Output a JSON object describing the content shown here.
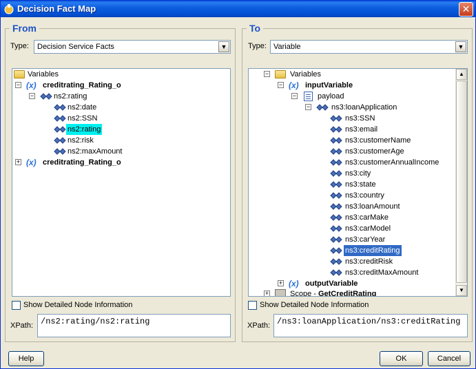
{
  "window": {
    "title": "Decision Fact Map",
    "close_label": "✕"
  },
  "from": {
    "legend": "From",
    "type_label": "Type:",
    "type_value": "Decision Service Facts",
    "tree": {
      "root": "Variables",
      "rating_o_1": "creditrating_Rating_o",
      "rating": "ns2:rating",
      "items": [
        "ns2:date",
        "ns2:SSN",
        "ns2:rating",
        "ns2:risk",
        "ns2:maxAmount"
      ],
      "rating_o_2": "creditrating_Rating_o",
      "var_symbol": "(x)"
    },
    "show_detail": "Show Detailed Node Information",
    "xpath_label": "XPath:",
    "xpath_value": "/ns2:rating/ns2:rating"
  },
  "to": {
    "legend": "To",
    "type_label": "Type:",
    "type_value": "Variable",
    "tree": {
      "root": "Variables",
      "input_var": "inputVariable",
      "payload": "payload",
      "loan_app": "ns3:loanApplication",
      "items": [
        "ns3:SSN",
        "ns3:email",
        "ns3:customerName",
        "ns3:customerAge",
        "ns3:customerAnnualIncome",
        "ns3:city",
        "ns3:state",
        "ns3:country",
        "ns3:loanAmount",
        "ns3:carMake",
        "ns3:carModel",
        "ns3:carYear",
        "ns3:creditRating",
        "ns3:creditRisk",
        "ns3:creditMaxAmount"
      ],
      "output_var": "outputVariable",
      "scope_prefix": "Scope - ",
      "scope_name": "GetCreditRating",
      "var_symbol": "(x)"
    },
    "show_detail": "Show Detailed Node Information",
    "xpath_label": "XPath:",
    "xpath_value": "/ns3:loanApplication/ns3:creditRating"
  },
  "buttons": {
    "help": "Help",
    "ok": "OK",
    "cancel": "Cancel"
  },
  "icons": {
    "folder": "folder-icon",
    "variable": "variable-icon",
    "element": "element-node-icon",
    "document": "document-icon",
    "scope": "scope-icon"
  },
  "colors": {
    "title_bar": "#0450d4",
    "legend": "#1c52c8",
    "highlight_cyan": "#00f0f0",
    "highlight_blue": "#316ac5"
  }
}
